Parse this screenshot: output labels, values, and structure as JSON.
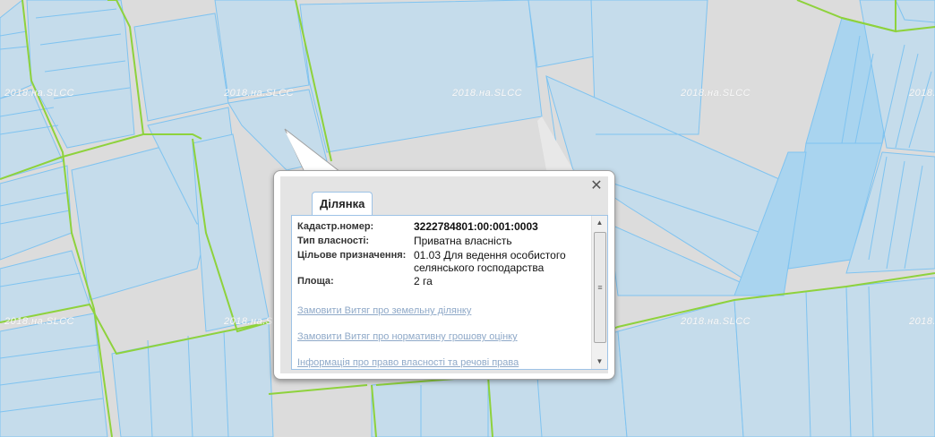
{
  "map": {
    "watermark_text": "2018.на.SLCC",
    "colors": {
      "background": "#dcdcdc",
      "parcel_fill": "#c5dceb",
      "parcel_border": "#7fc3f0",
      "boundary_line": "#8ed23c",
      "highlight_fill": "#a9d4ef"
    }
  },
  "popup": {
    "close_glyph": "✕",
    "tab_label": "Ділянка",
    "fields": [
      {
        "label": "Кадастр.номер:",
        "value": "3222784801:00:001:0003"
      },
      {
        "label": "Тип власності:",
        "value": "Приватна власність"
      },
      {
        "label": "Цільове призначення:",
        "value": "01.03 Для ведення особистого селянського господарства"
      },
      {
        "label": "Площа:",
        "value": "2 га"
      }
    ],
    "links": [
      "Замовити Витяг про земельну ділянку",
      "Замовити Витяг про нормативну грошову оцінку",
      "Інформація про право власності та речові права"
    ],
    "scroll_up_glyph": "▲",
    "scroll_down_glyph": "▼",
    "scroll_thumb_glyph": "≡"
  }
}
